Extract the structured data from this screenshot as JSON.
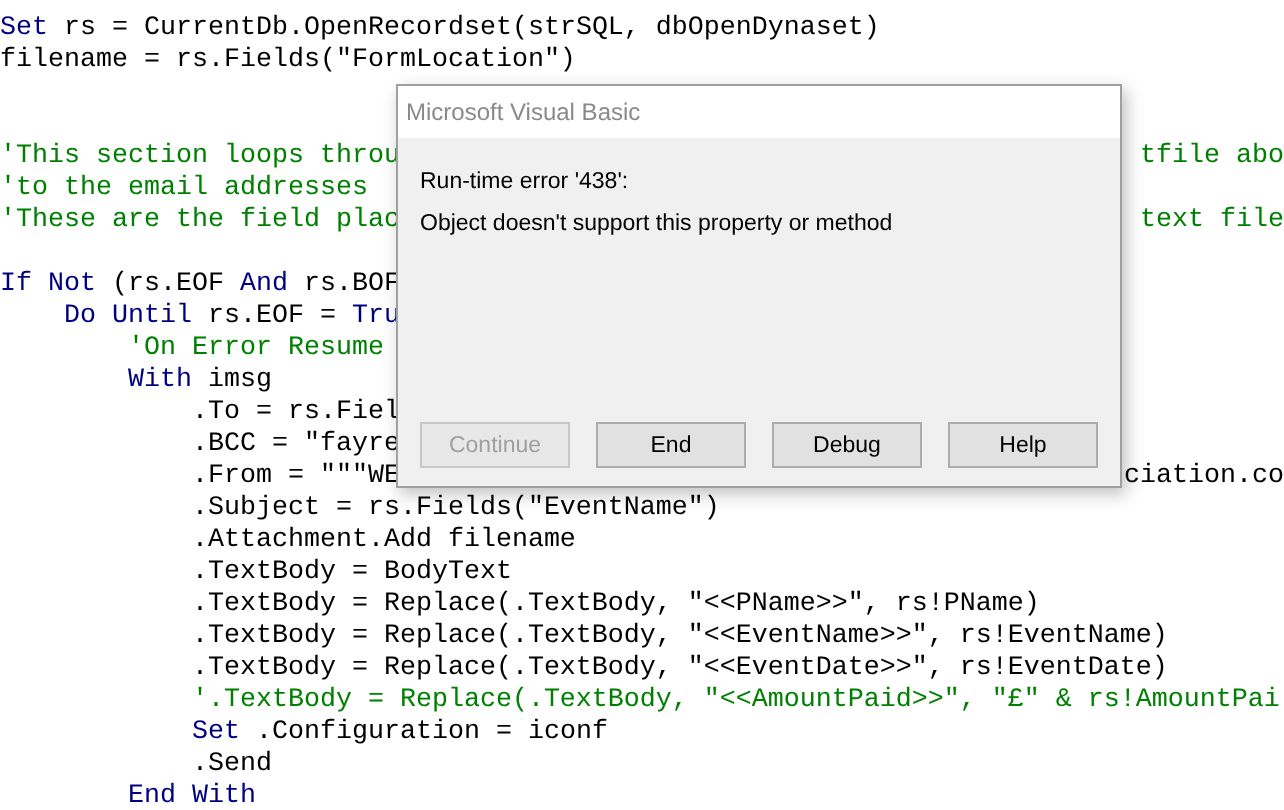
{
  "code_lines": [
    {
      "kind": "code",
      "left": [
        {
          "kind": "keyword",
          "text": "Set"
        },
        {
          "kind": "plain",
          "text": " rs = CurrentDb.OpenRecordset(strSQL, dbOpenDynaset)"
        }
      ]
    },
    {
      "kind": "code",
      "left": [
        {
          "kind": "plain",
          "text": "filename = rs.Fields(\"FormLocation\")"
        }
      ]
    },
    {
      "kind": "blank"
    },
    {
      "kind": "blank"
    },
    {
      "kind": "code",
      "left": [
        {
          "kind": "comment",
          "text": "'This section loops throu"
        }
      ],
      "right": [
        {
          "kind": "comment",
          "text": "tfile abo"
        }
      ]
    },
    {
      "kind": "code",
      "left": [
        {
          "kind": "comment",
          "text": "'to the email addresses"
        }
      ]
    },
    {
      "kind": "code",
      "left": [
        {
          "kind": "comment",
          "text": "'These are the field plac"
        }
      ],
      "right": [
        {
          "kind": "comment",
          "text": "text file"
        }
      ]
    },
    {
      "kind": "blank"
    },
    {
      "kind": "code",
      "left": [
        {
          "kind": "keyword",
          "text": "If Not"
        },
        {
          "kind": "plain",
          "text": " (rs.EOF "
        },
        {
          "kind": "keyword",
          "text": "And"
        },
        {
          "kind": "plain",
          "text": " rs.BOF"
        }
      ]
    },
    {
      "kind": "code",
      "left": [
        {
          "kind": "keyword",
          "text": "    Do Until"
        },
        {
          "kind": "plain",
          "text": " rs.EOF = "
        },
        {
          "kind": "keyword",
          "text": "Tru"
        }
      ]
    },
    {
      "kind": "code",
      "left": [
        {
          "kind": "comment",
          "text": "        'On Error Resume"
        }
      ]
    },
    {
      "kind": "code",
      "left": [
        {
          "kind": "keyword",
          "text": "        With"
        },
        {
          "kind": "plain",
          "text": " imsg"
        }
      ]
    },
    {
      "kind": "code",
      "left": [
        {
          "kind": "plain",
          "text": "            .To = rs.Fiel"
        }
      ]
    },
    {
      "kind": "code",
      "left": [
        {
          "kind": "plain",
          "text": "            .BCC = \"fayre"
        }
      ]
    },
    {
      "kind": "code",
      "left": [
        {
          "kind": "plain",
          "text": "            .From = \"\"\"WE"
        }
      ],
      "right": [
        {
          "kind": "plain",
          "text": "ciation.co"
        }
      ]
    },
    {
      "kind": "code",
      "left": [
        {
          "kind": "plain",
          "text": "            .Subject = rs.Fields(\"EventName\")"
        }
      ]
    },
    {
      "kind": "code",
      "left": [
        {
          "kind": "plain",
          "text": "            .Attachment.Add filename"
        }
      ]
    },
    {
      "kind": "code",
      "left": [
        {
          "kind": "plain",
          "text": "            .TextBody = BodyText"
        }
      ]
    },
    {
      "kind": "code",
      "left": [
        {
          "kind": "plain",
          "text": "            .TextBody = Replace(.TextBody, \"<<PName>>\", rs!PName)"
        }
      ]
    },
    {
      "kind": "code",
      "left": [
        {
          "kind": "plain",
          "text": "            .TextBody = Replace(.TextBody, \"<<EventName>>\", rs!EventName)"
        }
      ]
    },
    {
      "kind": "code",
      "left": [
        {
          "kind": "plain",
          "text": "            .TextBody = Replace(.TextBody, \"<<EventDate>>\", rs!EventDate)"
        }
      ]
    },
    {
      "kind": "code",
      "left": [
        {
          "kind": "comment",
          "text": "            '.TextBody = Replace(.TextBody, \"<<AmountPaid>>\", \"£\" & rs!AmountPai"
        }
      ]
    },
    {
      "kind": "code",
      "left": [
        {
          "kind": "keyword",
          "text": "            Set"
        },
        {
          "kind": "plain",
          "text": " .Configuration = iconf"
        }
      ]
    },
    {
      "kind": "code",
      "left": [
        {
          "kind": "plain",
          "text": "            .Send"
        }
      ]
    },
    {
      "kind": "code",
      "left": [
        {
          "kind": "keyword",
          "text": "        End With"
        }
      ]
    }
  ],
  "dialog": {
    "title": "Microsoft Visual Basic",
    "messages": [
      "Run-time error '438':",
      "Object doesn't support this property or method"
    ],
    "buttons": [
      {
        "label": "Continue",
        "disabled": true
      },
      {
        "label": "End",
        "disabled": false
      },
      {
        "label": "Debug",
        "disabled": false
      },
      {
        "label": "Help",
        "disabled": false
      }
    ]
  }
}
